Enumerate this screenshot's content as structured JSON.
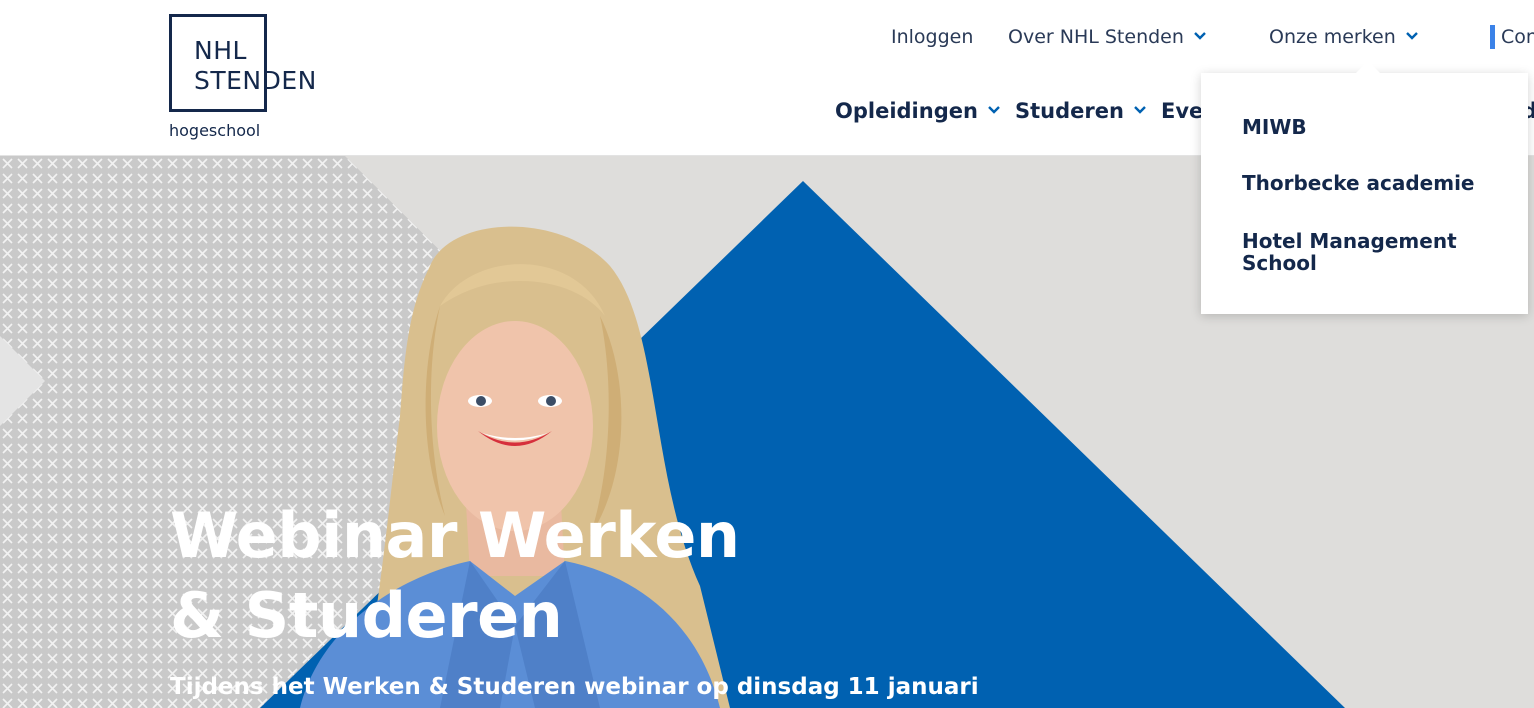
{
  "logo": {
    "line1": "NHL",
    "line2": "STENDEN",
    "subtitle": "hogeschool"
  },
  "top_nav": {
    "login": "Inloggen",
    "about": "Over NHL Stenden",
    "brands": "Onze merken",
    "contact": "Con"
  },
  "main_nav": {
    "programs": "Opleidingen",
    "study": "Studeren",
    "events": "Even",
    "last": "d"
  },
  "dropdown": {
    "items": [
      "MIWB",
      "Thorbecke academie",
      "Hotel Management School"
    ]
  },
  "hero": {
    "title": "Webinar Werken & Studeren",
    "subtitle": "Tijdens het Werken & Studeren webinar op dinsdag 11 januari"
  },
  "colors": {
    "navy": "#14284b",
    "brand_blue": "#0061b1",
    "accent": "#3b82e8",
    "hero_bg": "#dedddb"
  },
  "icons": {
    "chevron": "chevron-down-icon",
    "contact_marker": "focus-bar"
  }
}
